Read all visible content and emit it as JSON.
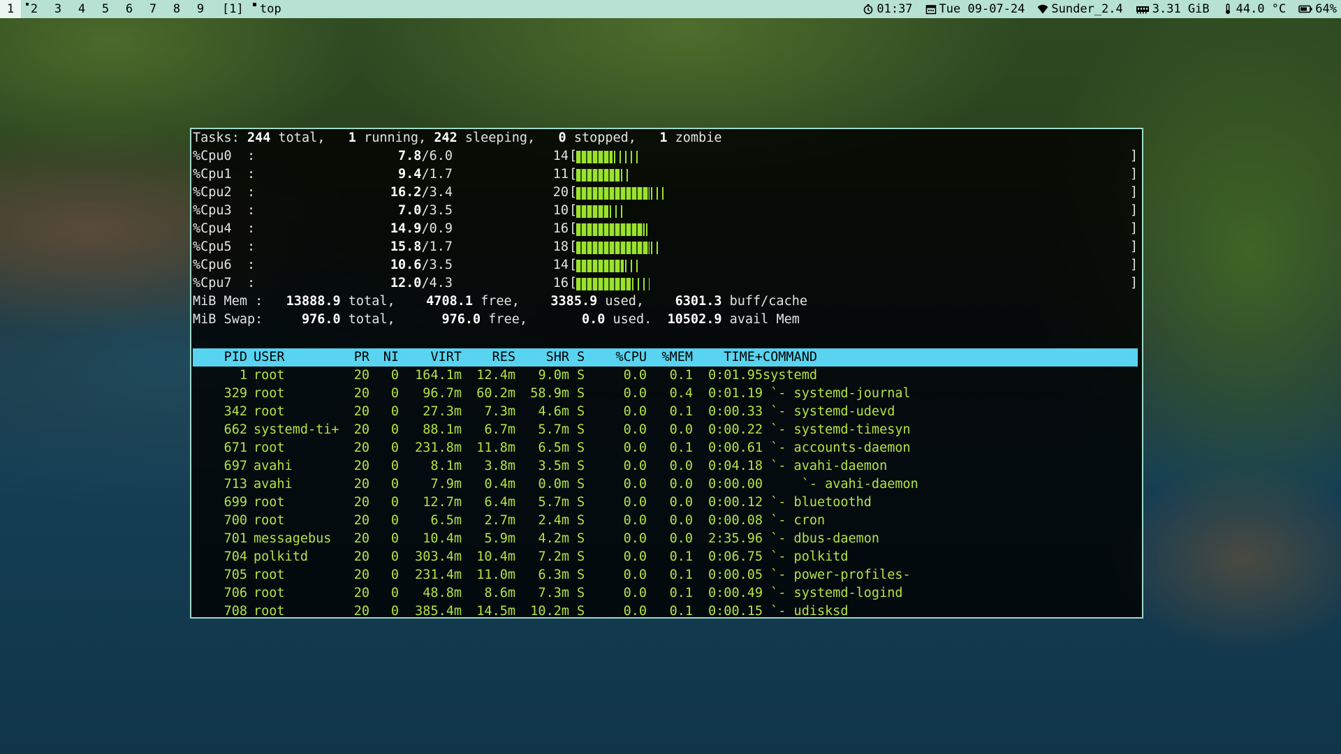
{
  "topbar": {
    "workspaces": [
      "1",
      "2",
      "3",
      "4",
      "5",
      "6",
      "7",
      "8",
      "9"
    ],
    "active_workspace": "1",
    "window_count": "[1]",
    "window_title": "top",
    "clock": "01:37",
    "date": "Tue 09-07-24",
    "wifi": "Sunder_2.4",
    "memory": "3.31 GiB",
    "temperature": "44.0 °C",
    "battery": "64%",
    "icons": [
      "clock-icon",
      "calendar-icon",
      "wifi-icon",
      "ram-icon",
      "thermometer-icon",
      "battery-icon"
    ]
  },
  "summary": {
    "tasks_label": "Tasks:",
    "tasks_total": "244",
    "total_label": "total,",
    "running": "1",
    "running_label": "running,",
    "sleeping": "242",
    "sleeping_label": "sleeping,",
    "stopped": "0",
    "stopped_label": "stopped,",
    "zombie": "1",
    "zombie_label": "zombie"
  },
  "cpus": [
    {
      "label": "%Cpu0  :",
      "user": "7.8",
      "sys": "6.0",
      "pct": "14",
      "solid": 0.066,
      "tail": 0.047
    },
    {
      "label": "%Cpu1  :",
      "user": "9.4",
      "sys": "1.7",
      "pct": "11",
      "solid": 0.078,
      "tail": 0.016
    },
    {
      "label": "%Cpu2  :",
      "user": "16.2",
      "sys": "3.4",
      "pct": "20",
      "solid": 0.133,
      "tail": 0.024
    },
    {
      "label": "%Cpu3  :",
      "user": "7.0",
      "sys": "3.5",
      "pct": "10",
      "solid": 0.058,
      "tail": 0.024
    },
    {
      "label": "%Cpu4  :",
      "user": "14.9",
      "sys": "0.9",
      "pct": "16",
      "solid": 0.124,
      "tail": 0.008
    },
    {
      "label": "%Cpu5  :",
      "user": "15.8",
      "sys": "1.7",
      "pct": "18",
      "solid": 0.133,
      "tail": 0.016
    },
    {
      "label": "%Cpu6  :",
      "user": "10.6",
      "sys": "3.5",
      "pct": "14",
      "solid": 0.086,
      "tail": 0.024
    },
    {
      "label": "%Cpu7  :",
      "user": "12.0",
      "sys": "4.3",
      "pct": "16",
      "solid": 0.099,
      "tail": 0.032
    }
  ],
  "memory": {
    "mem_label": "MiB Mem :",
    "mem_total": "13888.9",
    "mem_free": "4708.1",
    "mem_used": "3385.9",
    "mem_buff": "6301.3",
    "swap_label": "MiB Swap:",
    "swap_total": "976.0",
    "swap_free": "976.0",
    "swap_used": "0.0",
    "avail": "10502.9",
    "total_label": "total,",
    "free_label": "free,",
    "used_label": "used,",
    "used_label2": "used.",
    "buff_label": "buff/cache",
    "avail_label": "avail Mem"
  },
  "columns": [
    "PID",
    "USER",
    "PR",
    "NI",
    "VIRT",
    "RES",
    "SHR",
    "S",
    "%CPU",
    "%MEM",
    "TIME+",
    "COMMAND"
  ],
  "processes": [
    {
      "pid": "1",
      "user": "root",
      "pr": "20",
      "ni": "0",
      "virt": "164.1m",
      "res": "12.4m",
      "shr": "9.0m",
      "s": "S",
      "cpu": "0.0",
      "mem": "0.1",
      "time": "0:01.95",
      "cmd": "systemd"
    },
    {
      "pid": "329",
      "user": "root",
      "pr": "20",
      "ni": "0",
      "virt": "96.7m",
      "res": "60.2m",
      "shr": "58.9m",
      "s": "S",
      "cpu": "0.0",
      "mem": "0.4",
      "time": "0:01.19",
      "cmd": " `- systemd-journal"
    },
    {
      "pid": "342",
      "user": "root",
      "pr": "20",
      "ni": "0",
      "virt": "27.3m",
      "res": "7.3m",
      "shr": "4.6m",
      "s": "S",
      "cpu": "0.0",
      "mem": "0.1",
      "time": "0:00.33",
      "cmd": " `- systemd-udevd"
    },
    {
      "pid": "662",
      "user": "systemd-ti+",
      "pr": "20",
      "ni": "0",
      "virt": "88.1m",
      "res": "6.7m",
      "shr": "5.7m",
      "s": "S",
      "cpu": "0.0",
      "mem": "0.0",
      "time": "0:00.22",
      "cmd": " `- systemd-timesyn"
    },
    {
      "pid": "671",
      "user": "root",
      "pr": "20",
      "ni": "0",
      "virt": "231.8m",
      "res": "11.8m",
      "shr": "6.5m",
      "s": "S",
      "cpu": "0.0",
      "mem": "0.1",
      "time": "0:00.61",
      "cmd": " `- accounts-daemon"
    },
    {
      "pid": "697",
      "user": "avahi",
      "pr": "20",
      "ni": "0",
      "virt": "8.1m",
      "res": "3.8m",
      "shr": "3.5m",
      "s": "S",
      "cpu": "0.0",
      "mem": "0.0",
      "time": "0:04.18",
      "cmd": " `- avahi-daemon"
    },
    {
      "pid": "713",
      "user": "avahi",
      "pr": "20",
      "ni": "0",
      "virt": "7.9m",
      "res": "0.4m",
      "shr": "0.0m",
      "s": "S",
      "cpu": "0.0",
      "mem": "0.0",
      "time": "0:00.00",
      "cmd": "     `- avahi-daemon"
    },
    {
      "pid": "699",
      "user": "root",
      "pr": "20",
      "ni": "0",
      "virt": "12.7m",
      "res": "6.4m",
      "shr": "5.7m",
      "s": "S",
      "cpu": "0.0",
      "mem": "0.0",
      "time": "0:00.12",
      "cmd": " `- bluetoothd"
    },
    {
      "pid": "700",
      "user": "root",
      "pr": "20",
      "ni": "0",
      "virt": "6.5m",
      "res": "2.7m",
      "shr": "2.4m",
      "s": "S",
      "cpu": "0.0",
      "mem": "0.0",
      "time": "0:00.08",
      "cmd": " `- cron"
    },
    {
      "pid": "701",
      "user": "messagebus",
      "pr": "20",
      "ni": "0",
      "virt": "10.4m",
      "res": "5.9m",
      "shr": "4.2m",
      "s": "S",
      "cpu": "0.0",
      "mem": "0.0",
      "time": "2:35.96",
      "cmd": " `- dbus-daemon"
    },
    {
      "pid": "704",
      "user": "polkitd",
      "pr": "20",
      "ni": "0",
      "virt": "303.4m",
      "res": "10.4m",
      "shr": "7.2m",
      "s": "S",
      "cpu": "0.0",
      "mem": "0.1",
      "time": "0:06.75",
      "cmd": " `- polkitd"
    },
    {
      "pid": "705",
      "user": "root",
      "pr": "20",
      "ni": "0",
      "virt": "231.4m",
      "res": "11.0m",
      "shr": "6.3m",
      "s": "S",
      "cpu": "0.0",
      "mem": "0.1",
      "time": "0:00.05",
      "cmd": " `- power-profiles-"
    },
    {
      "pid": "706",
      "user": "root",
      "pr": "20",
      "ni": "0",
      "virt": "48.8m",
      "res": "8.6m",
      "shr": "7.3m",
      "s": "S",
      "cpu": "0.0",
      "mem": "0.1",
      "time": "0:00.49",
      "cmd": " `- systemd-logind"
    },
    {
      "pid": "708",
      "user": "root",
      "pr": "20",
      "ni": "0",
      "virt": "385.4m",
      "res": "14.5m",
      "shr": "10.2m",
      "s": "S",
      "cpu": "0.0",
      "mem": "0.1",
      "time": "0:00.15",
      "cmd": " `- udisksd"
    }
  ],
  "colors": {
    "topbar_bg": "#b6e1d3",
    "header_bg": "#58d4f0",
    "bar_green": "#9be22d",
    "process_text": "#b3e344",
    "terminal_border": "#9fd9c8"
  }
}
